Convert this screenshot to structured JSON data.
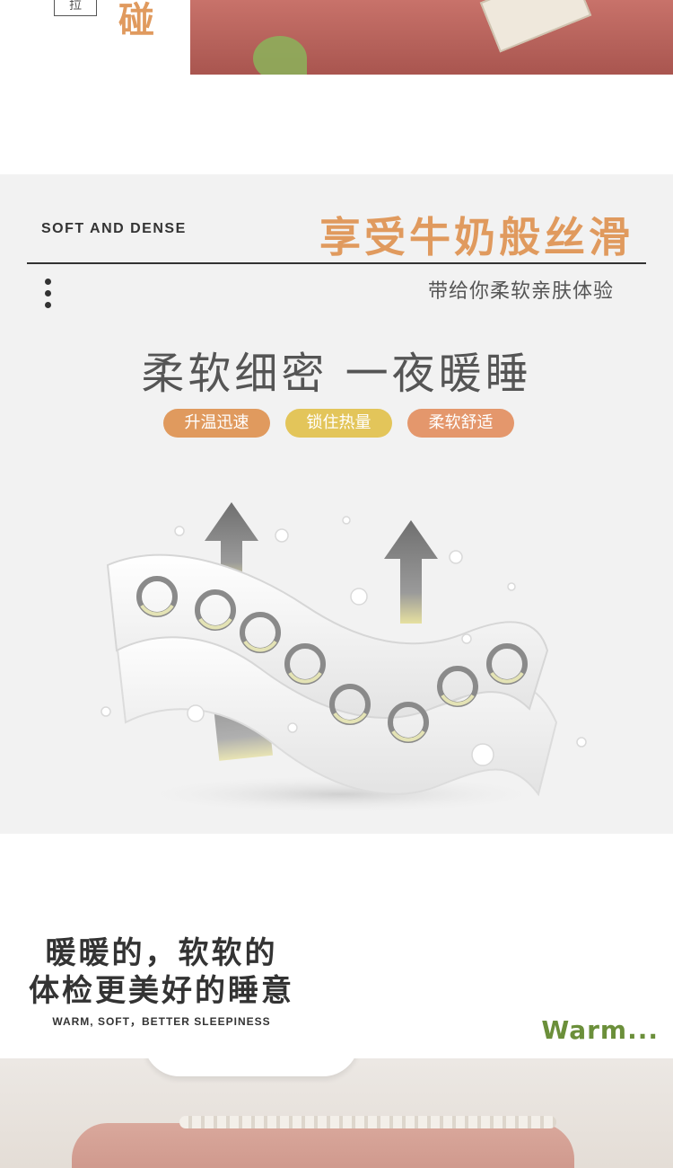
{
  "top": {
    "box_char": "拉",
    "big_char": "碰"
  },
  "feature": {
    "en_label": "SOFT AND DENSE",
    "title": "享受牛奶般丝滑",
    "subtitle": "带给你柔软亲肤体验",
    "headline": "柔软细密  一夜暖睡",
    "tags": [
      {
        "label": "升温迅速",
        "color": "#e09a5e"
      },
      {
        "label": "锁住热量",
        "color": "#e3c55a"
      },
      {
        "label": "柔软舒适",
        "color": "#e4976c"
      }
    ]
  },
  "warm": {
    "line1": "暖暖的，软软的",
    "line2": "体检更美好的睡意",
    "en": "WARM, SOFT，BETTER SLEEPINESS",
    "script": "Warm..."
  },
  "colors": {
    "accent_orange": "#e09a5e",
    "accent_yellow": "#e3c55a",
    "accent_green": "#6b8f3a",
    "panel_gray": "#f2f2f2"
  }
}
